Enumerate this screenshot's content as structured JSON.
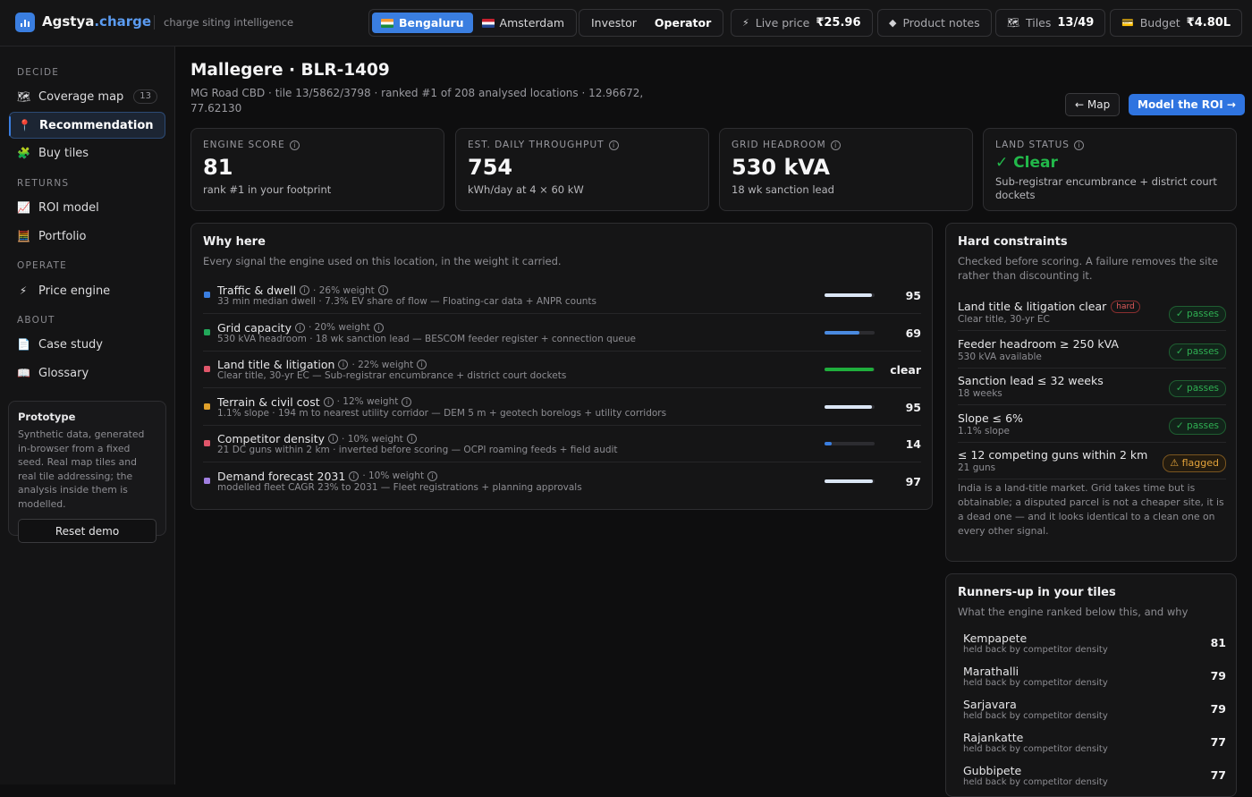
{
  "brand": {
    "name": "Agstya",
    "suffix": ".charge",
    "tagline": "charge siting intelligence"
  },
  "city_toggle": {
    "options": [
      {
        "label": "Bengaluru",
        "flag": "india-flag",
        "active": true
      },
      {
        "label": "Amsterdam",
        "flag": "netherlands-flag",
        "active": false
      }
    ]
  },
  "role_toggle": {
    "options": [
      {
        "label": "Investor",
        "active": false
      },
      {
        "label": "Operator",
        "active": true
      }
    ]
  },
  "chips": {
    "live_price": {
      "label": "Live price",
      "value": "₹25.96",
      "icon": "bolt-icon"
    },
    "product_notes": {
      "label": "Product notes",
      "icon": "diamond-icon"
    },
    "tiles": {
      "label": "Tiles",
      "value": "13/49",
      "icon": "map-icon"
    },
    "budget": {
      "label": "Budget",
      "value": "₹4.80L",
      "icon": "card-icon"
    }
  },
  "sidebar": {
    "sections": [
      {
        "label": "DECIDE",
        "items": [
          {
            "label": "Coverage map",
            "icon": "map-icon",
            "badge": "13"
          },
          {
            "label": "Recommendation",
            "icon": "pin-icon",
            "active": true
          },
          {
            "label": "Buy tiles",
            "icon": "puzzle-icon"
          }
        ]
      },
      {
        "label": "RETURNS",
        "items": [
          {
            "label": "ROI model",
            "icon": "chart-icon"
          },
          {
            "label": "Portfolio",
            "icon": "abacus-icon"
          }
        ]
      },
      {
        "label": "OPERATE",
        "items": [
          {
            "label": "Price engine",
            "icon": "bolt-icon"
          }
        ]
      },
      {
        "label": "ABOUT",
        "items": [
          {
            "label": "Case study",
            "icon": "document-icon"
          },
          {
            "label": "Glossary",
            "icon": "book-icon"
          }
        ]
      }
    ],
    "prototype": {
      "title": "Prototype",
      "text": "Synthetic data, generated in-browser from a fixed seed. Real map tiles and real tile addressing; the analysis inside them is modelled.",
      "button": "Reset demo"
    }
  },
  "page": {
    "title": "Mallegere · BLR-1409",
    "subtitle": "MG Road CBD · tile 13/5862/3798 · ranked #1 of 208 analysed locations · 12.96672, 77.62130",
    "map_button": "← Map",
    "roi_button": "Model the ROI →"
  },
  "kpis": [
    {
      "label": "ENGINE SCORE",
      "value": "81",
      "sub": "rank #1 in your footprint"
    },
    {
      "label": "EST. DAILY THROUGHPUT",
      "value": "754",
      "sub": "kWh/day at 4 × 60 kW"
    },
    {
      "label": "GRID HEADROOM",
      "value": "530 kVA",
      "sub": "18 wk sanction lead"
    },
    {
      "label": "LAND STATUS",
      "value": "✓ Clear",
      "sub": "Sub-registrar encumbrance + district court dockets"
    }
  ],
  "why_here": {
    "title": "Why here",
    "desc": "Every signal the engine used on this location, in the weight it carried.",
    "signals": [
      {
        "name": "Traffic & dwell",
        "weight": "· 26% weight",
        "detail": "33 min median dwell · 7.3% EV share of flow — Floating-car data + ANPR counts",
        "score": "95",
        "fill": 0.95,
        "color": "#3a7ee0",
        "bar": "#dbe6f5"
      },
      {
        "name": "Grid capacity",
        "weight": "· 20% weight",
        "detail": "530 kVA headroom · 18 wk sanction lead — BESCOM feeder register + connection queue",
        "score": "69",
        "fill": 0.69,
        "color": "#22a85a",
        "bar": "#4a8ae0"
      },
      {
        "name": "Land title & litigation",
        "weight": "· 22% weight",
        "detail": "Clear title, 30-yr EC — Sub-registrar encumbrance + district court dockets",
        "score": "clear",
        "fill": 0.98,
        "color": "#e0566a",
        "bar": "#1fae3c"
      },
      {
        "name": "Terrain & civil cost",
        "weight": "· 12% weight",
        "detail": "1.1% slope · 194 m to nearest utility corridor — DEM 5 m + geotech borelogs + utility corridors",
        "score": "95",
        "fill": 0.95,
        "color": "#e0a02a",
        "bar": "#dbe6f5"
      },
      {
        "name": "Competitor density",
        "weight": "· 10% weight",
        "detail": "21 DC guns within 2 km · inverted before scoring — OCPI roaming feeds + field audit",
        "score": "14",
        "fill": 0.14,
        "color": "#e0566a",
        "bar": "#3a7ee0"
      },
      {
        "name": "Demand forecast 2031",
        "weight": "· 10% weight",
        "detail": "modelled fleet CAGR 23% to 2031 — Fleet registrations + planning approvals",
        "score": "97",
        "fill": 0.97,
        "color": "#a07ee0",
        "bar": "#dbe6f5"
      }
    ]
  },
  "hard_constraints": {
    "title": "Hard constraints",
    "desc": "Checked before scoring. A failure removes the site rather than discounting it.",
    "items": [
      {
        "name": "Land title & litigation clear",
        "tag": "hard",
        "detail": "Clear title, 30-yr EC",
        "status": "✓ passes",
        "flagged": false
      },
      {
        "name": "Feeder headroom ≥ 250 kVA",
        "detail": "530 kVA available",
        "status": "✓ passes",
        "flagged": false
      },
      {
        "name": "Sanction lead ≤ 32 weeks",
        "detail": "18 weeks",
        "status": "✓ passes",
        "flagged": false
      },
      {
        "name": "Slope ≤ 6%",
        "detail": "1.1% slope",
        "status": "✓ passes",
        "flagged": false
      },
      {
        "name": "≤ 12 competing guns within 2 km",
        "detail": "21 guns",
        "status": "⚠ flagged",
        "flagged": true
      }
    ],
    "note": "India is a land-title market. Grid takes time but is obtainable; a disputed parcel is not a cheaper site, it is a dead one — and it looks identical to a clean one on every other signal."
  },
  "runners_up": {
    "title": "Runners-up in your tiles",
    "desc": "What the engine ranked below this, and why",
    "items": [
      {
        "name": "Kempapete",
        "reason": "held back by competitor density",
        "score": "81"
      },
      {
        "name": "Marathalli",
        "reason": "held back by competitor density",
        "score": "79"
      },
      {
        "name": "Sarjavara",
        "reason": "held back by competitor density",
        "score": "79"
      },
      {
        "name": "Rajankatte",
        "reason": "held back by competitor density",
        "score": "77"
      },
      {
        "name": "Gubbipete",
        "reason": "held back by competitor density",
        "score": "77"
      }
    ]
  }
}
